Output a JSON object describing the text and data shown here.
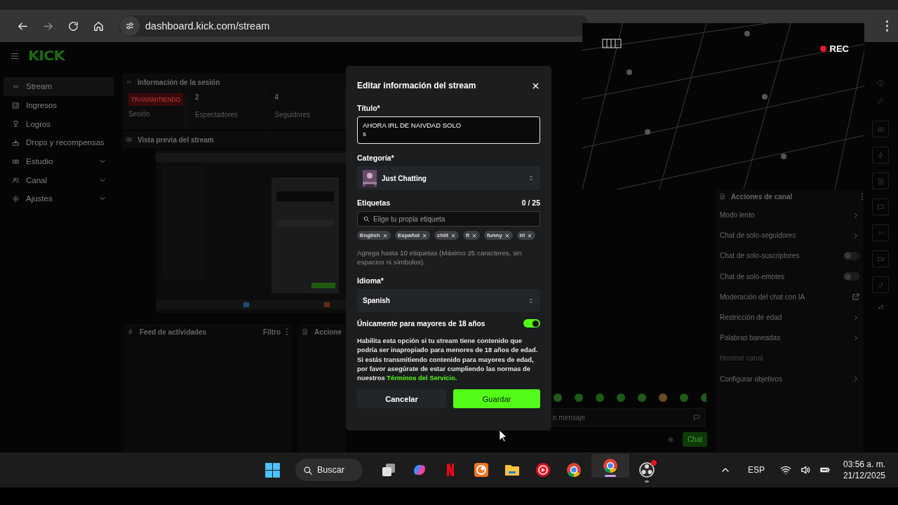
{
  "browser": {
    "url": "dashboard.kick.com/stream"
  },
  "header": {
    "logo": "KICK"
  },
  "sidebar": {
    "items": [
      {
        "label": "Stream",
        "selected": true,
        "expandable": false
      },
      {
        "label": "Ingresos",
        "selected": false,
        "expandable": false
      },
      {
        "label": "Logros",
        "selected": false,
        "expandable": false
      },
      {
        "label": "Drops y recompensas",
        "selected": false,
        "expandable": false
      },
      {
        "label": "Estudio",
        "selected": false,
        "expandable": true
      },
      {
        "label": "Canal",
        "selected": false,
        "expandable": true
      },
      {
        "label": "Ajustes",
        "selected": false,
        "expandable": true
      }
    ]
  },
  "session": {
    "title": "Información de la sesión",
    "status": "TRANSMITIENDO",
    "status_label": "Sesión",
    "stats": [
      {
        "value": "2",
        "label": "Espectadores"
      },
      {
        "value": "4",
        "label": "Seguidores"
      }
    ]
  },
  "preview": {
    "title": "Vista previa del stream",
    "kind": "picture"
  },
  "activity_feed": {
    "title": "Feed de actividades",
    "filter": "Filtro"
  },
  "actions_panel": {
    "title": "Accione"
  },
  "chat": {
    "placeholder": "n mensaje",
    "send": "Chat"
  },
  "channel_actions": {
    "title": "Acciones de canal",
    "items": [
      {
        "label": "Modo lento",
        "kind": "link",
        "disabled": false
      },
      {
        "label": "Chat de solo-seguidores",
        "kind": "link",
        "disabled": false
      },
      {
        "label": "Chat de solo-suscriptores",
        "kind": "toggle",
        "on": false,
        "disabled": false
      },
      {
        "label": "Chat de solo-emotes",
        "kind": "toggle",
        "on": false,
        "disabled": false
      },
      {
        "label": "Moderación del chat con IA",
        "kind": "external",
        "disabled": false
      },
      {
        "label": "Restricción de edad",
        "kind": "link",
        "disabled": false
      },
      {
        "label": "Palabras baneadas",
        "kind": "link",
        "disabled": false
      },
      {
        "label": "Hostear canal",
        "kind": "plain",
        "disabled": true
      },
      {
        "label": "Configurar objetivos",
        "kind": "link",
        "disabled": false
      }
    ]
  },
  "camera_overlay": {
    "rec": "REC"
  },
  "modal": {
    "title": "Editar información del stream",
    "title_field": {
      "label": "Título*",
      "value": "AHORA IRL DE NAIVDAD SOLO\ns"
    },
    "category": {
      "label": "Categoría*",
      "value": "Just Chatting"
    },
    "tags": {
      "label": "Etiquetas",
      "count": "0 / 25",
      "placeholder": "Elige tu propia etiqueta",
      "items": [
        "English",
        "Español",
        "chill",
        "fl",
        "funny",
        "irl"
      ],
      "hint": "Agrega hasta 10 etiquetas (Máximo 25 caracteres, sin espacios ni símbolos)."
    },
    "language": {
      "label": "Idioma*",
      "value": "Spanish"
    },
    "mature": {
      "label": "Únicamente para mayores de 18 años",
      "on": true,
      "description": "Habilita esta opción si tu stream tiene contenido que podría ser inapropiado para menores de 18 años de edad. Si estás transmitiendo contenido para mayores de edad, por favor asegúrate de estar cumpliendo las normas de nuestros",
      "link": "Términos del Servicio."
    },
    "cancel": "Cancelar",
    "save": "Guardar"
  },
  "taskbar": {
    "search": "Buscar",
    "apps": [
      {
        "kind": "taskview",
        "selected": false,
        "running": false,
        "badge": false
      },
      {
        "kind": "swirl",
        "selected": false,
        "running": false,
        "badge": false
      },
      {
        "kind": "ribbon",
        "selected": false,
        "running": false,
        "badge": false
      },
      {
        "kind": "crescent",
        "selected": false,
        "running": false,
        "badge": false
      },
      {
        "kind": "folder",
        "selected": false,
        "running": false,
        "badge": false
      },
      {
        "kind": "play",
        "selected": false,
        "running": false,
        "badge": false
      },
      {
        "kind": "browser",
        "selected": false,
        "running": false,
        "badge": false
      },
      {
        "kind": "browser",
        "selected": true,
        "running": true,
        "badge": false
      },
      {
        "kind": "aperture",
        "selected": false,
        "running": true,
        "badge": true
      }
    ],
    "language": "ESP",
    "time": "03:56 a. m.",
    "date": "21/12/2025"
  }
}
